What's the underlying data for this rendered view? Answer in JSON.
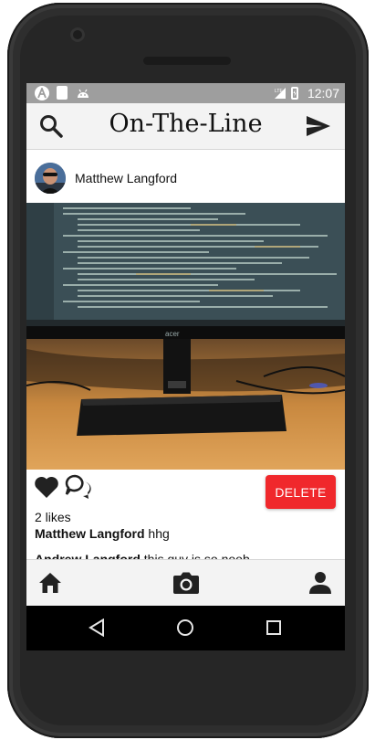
{
  "status_bar": {
    "time": "12:07",
    "icons": [
      "app-a-icon",
      "sd-card-icon",
      "android-debug-icon",
      "lte-signal-icon",
      "battery-icon"
    ]
  },
  "app_bar": {
    "title": "On-The-Line",
    "left_icon": "search-icon",
    "right_icon": "send-icon"
  },
  "post": {
    "author": "Matthew Langford",
    "image": "photo of a monitor showing code on a desk",
    "actions": {
      "like_icon": "heart-icon",
      "comment_icon": "comment-icon",
      "delete_label": "DELETE"
    },
    "likes": "2 likes",
    "caption": {
      "author": "Matthew Langford",
      "text": " hhg"
    },
    "comments": [
      {
        "author": "Andrew Langford",
        "text": " this guy is so noob"
      }
    ]
  },
  "bottom_nav": {
    "items": [
      "home-icon",
      "camera-icon",
      "profile-icon"
    ]
  },
  "colors": {
    "delete_button": "#f0282c",
    "status_bar": "#9e9e9e",
    "app_bar": "#f3f3f3"
  }
}
